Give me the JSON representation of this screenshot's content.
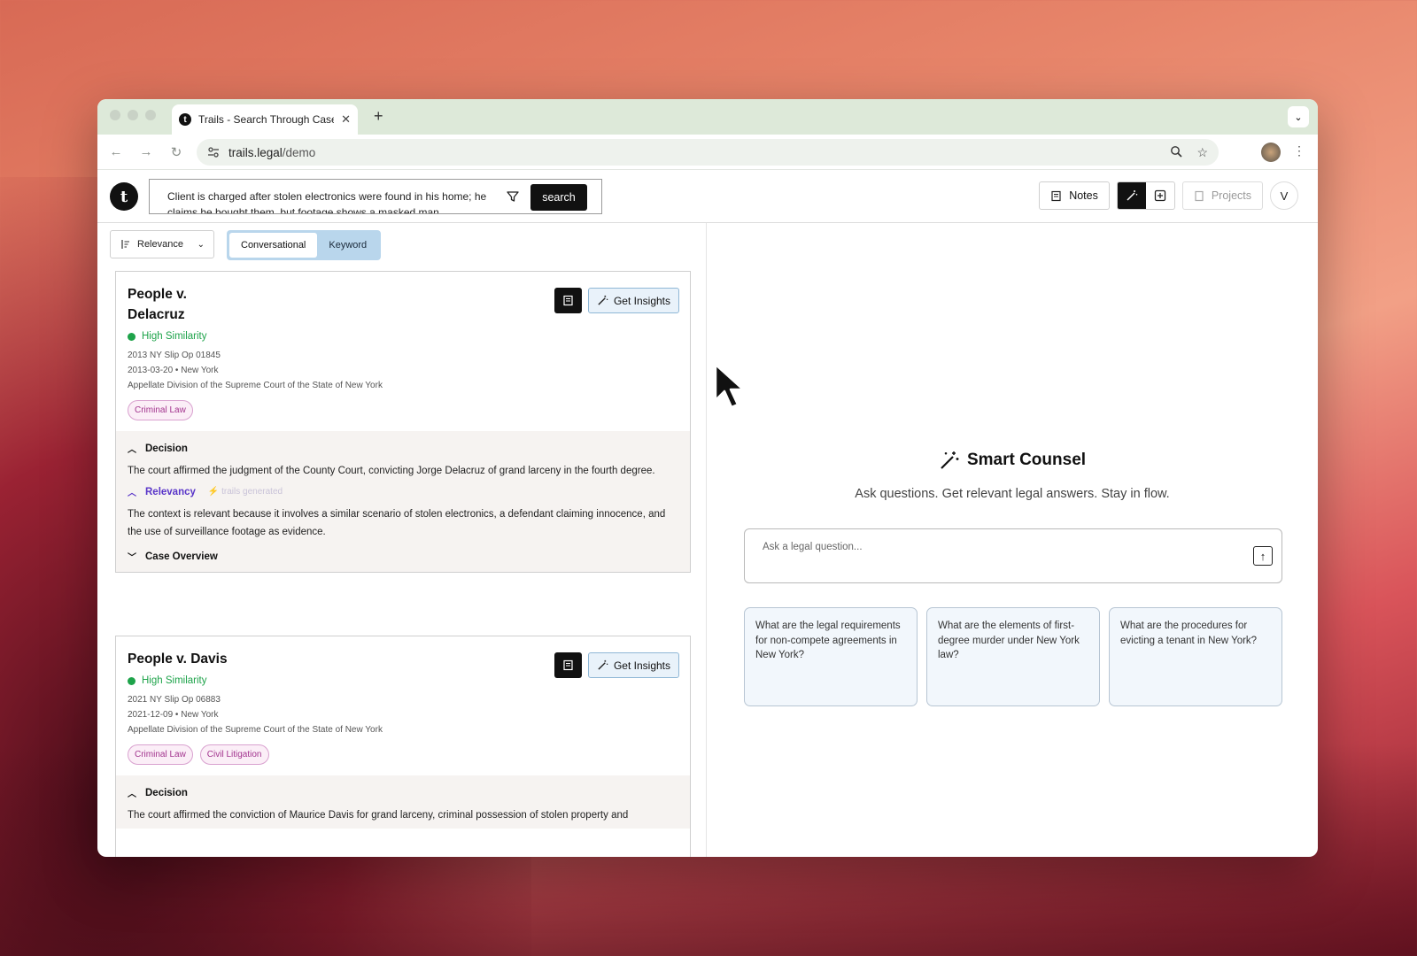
{
  "browser": {
    "tab_title": "Trails - Search Through Case",
    "tab_favicon": "t",
    "url_host": "trails.legal",
    "url_path": "/demo"
  },
  "header": {
    "logo_letter": "t",
    "search_query": "Client is charged after stolen electronics were found in his home; he claims he bought them, but footage shows a masked man",
    "search_button": "search",
    "notes_label": "Notes",
    "projects_label": "Projects",
    "avatar_letter": "V"
  },
  "controls": {
    "sort_label": "Relevance",
    "mode_conversational": "Conversational",
    "mode_keyword": "Keyword"
  },
  "cases": [
    {
      "title": "People v. Delacruz",
      "similarity": "High Similarity",
      "citation": "2013 NY Slip Op 01845",
      "date": "2013-03-20",
      "location": "New York",
      "court": "Appellate Division of the Supreme Court of the State of New York",
      "tags": [
        "Criminal Law"
      ],
      "insights_label": "Get Insights",
      "decision_heading": "Decision",
      "decision_text": "The court affirmed the judgment of the County Court, convicting Jorge Delacruz of grand larceny in the fourth degree.",
      "relevancy_heading": "Relevancy",
      "generated_label": "trails generated",
      "relevancy_text": "The context is relevant because it involves a similar scenario of stolen electronics, a defendant claiming innocence, and the use of surveillance footage as evidence.",
      "overview_heading": "Case Overview"
    },
    {
      "title": "People v. Davis",
      "similarity": "High Similarity",
      "citation": "2021 NY Slip Op 06883",
      "date": "2021-12-09",
      "location": "New York",
      "court": "Appellate Division of the Supreme Court of the State of New York",
      "tags": [
        "Criminal Law",
        "Civil Litigation"
      ],
      "insights_label": "Get Insights",
      "decision_heading": "Decision",
      "decision_text": "The court affirmed the conviction of Maurice Davis for grand larceny, criminal possession of stolen property and"
    }
  ],
  "smart_counsel": {
    "title": "Smart Counsel",
    "subtitle": "Ask questions. Get relevant legal answers. Stay in flow.",
    "placeholder": "Ask a legal question...",
    "suggestions": [
      "What are the legal requirements for non-compete agreements in New York?",
      "What are the elements of first-degree murder under New York law?",
      "What are the procedures for evicting a tenant in New York?"
    ]
  }
}
